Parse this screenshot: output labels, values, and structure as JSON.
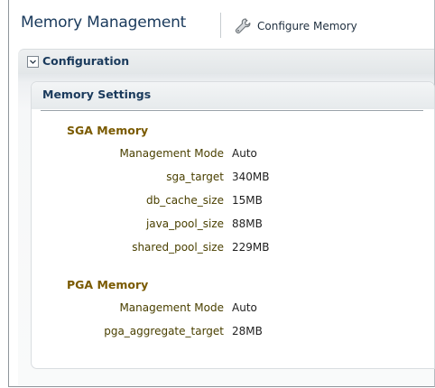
{
  "header": {
    "title": "Memory Management",
    "configure_label": "Configure Memory",
    "configure_icon": "wrench-icon"
  },
  "configuration": {
    "label": "Configuration",
    "expanded": true,
    "disclosure_icon": "chevron-down-icon"
  },
  "memory_settings": {
    "title": "Memory Settings",
    "sga": {
      "title": "SGA Memory",
      "rows": [
        {
          "label": "Management Mode",
          "value": "Auto"
        },
        {
          "label": "sga_target",
          "value": "340MB"
        },
        {
          "label": "db_cache_size",
          "value": "15MB"
        },
        {
          "label": "java_pool_size",
          "value": "88MB"
        },
        {
          "label": "shared_pool_size",
          "value": "229MB"
        }
      ]
    },
    "pga": {
      "title": "PGA Memory",
      "rows": [
        {
          "label": "Management Mode",
          "value": "Auto"
        },
        {
          "label": "pga_aggregate_target",
          "value": "28MB"
        }
      ]
    }
  },
  "colors": {
    "title_text": "#1a3a5c",
    "section_title": "#7a5a00",
    "field_label": "#4a4000"
  }
}
